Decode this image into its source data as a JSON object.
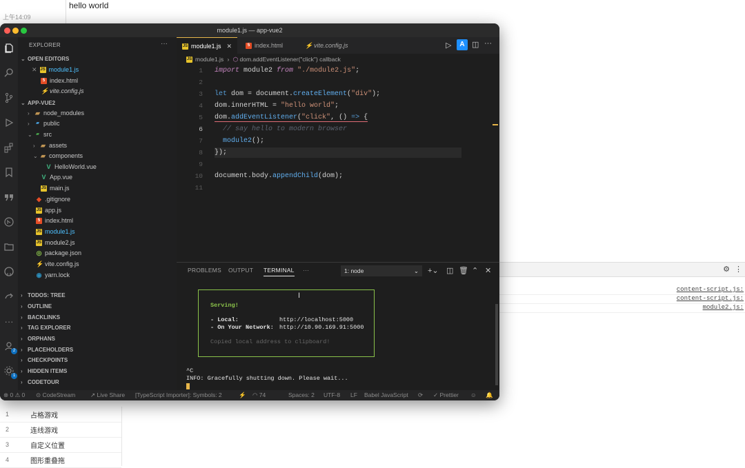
{
  "background": {
    "time": "上午14:09",
    "hello": "hello world",
    "devtools_links": [
      "content-script.js:",
      "content-script.js:",
      "module2.js:"
    ],
    "list": [
      {
        "n": "1",
        "t": "占格游戏"
      },
      {
        "n": "2",
        "t": "连线游戏"
      },
      {
        "n": "3",
        "t": "自定义位置"
      },
      {
        "n": "4",
        "t": "图形重叠拖"
      }
    ]
  },
  "window": {
    "title": "module1.js — app-vue2"
  },
  "sidebar": {
    "header": "EXPLORER",
    "open_editors": "OPEN EDITORS",
    "open_files": [
      "module1.js",
      "index.html",
      "vite.config.js"
    ],
    "project": "APP-VUE2",
    "tree": [
      "node_modules",
      "public",
      "src",
      "assets",
      "components",
      "HelloWorld.vue",
      "App.vue",
      "main.js",
      ".gitignore",
      "app.js",
      "index.html",
      "module1.js",
      "module2.js",
      "package.json",
      "vite.config.js",
      "yarn.lock"
    ],
    "sections": [
      "TODOS: TREE",
      "OUTLINE",
      "BACKLINKS",
      "TAG EXPLORER",
      "ORPHANS",
      "PLACEHOLDERS",
      "CHECKPOINTS",
      "HIDDEN ITEMS",
      "CODETOUR"
    ]
  },
  "tabs": [
    "module1.js",
    "index.html",
    "vite.config.js"
  ],
  "breadcrumb": {
    "file": "module1.js",
    "sep": "›",
    "symbol": "dom.addEventListener(\"click\") callback"
  },
  "editor": {
    "line_numbers": [
      "1",
      "2",
      "3",
      "4",
      "5",
      "6",
      "7",
      "8",
      "9",
      "10",
      "11"
    ]
  },
  "panel": {
    "tabs": [
      "PROBLEMS",
      "OUTPUT",
      "TERMINAL",
      "···"
    ],
    "terminal_select": "1: node",
    "serving": "Serving!",
    "local_label": "- Local:",
    "local_url": "http://localhost:5000",
    "network_label": "- On Your Network:",
    "network_url": "http://10.90.169.91:5000",
    "copied": "Copied local address to clipboard!",
    "ctrl_c": "^C",
    "info": "INFO: Gracefully shutting down. Please wait..."
  },
  "status": {
    "problems": "⊗ 0 ⚠ 0",
    "codestream": "CodeStream",
    "liveshare": "Live Share",
    "ts_importer": "[TypeScript Importer]: Symbols: 2",
    "count": "74",
    "spaces": "Spaces: 2",
    "encoding": "UTF-8",
    "eol": "LF",
    "language": "Babel JavaScript",
    "prettier": "Prettier"
  },
  "badges": {
    "account": "2",
    "settings": "1"
  },
  "colors": {
    "accent": "#e7b64a",
    "terminal_border": "#8bc34a",
    "selected": "#4fc1ff"
  }
}
